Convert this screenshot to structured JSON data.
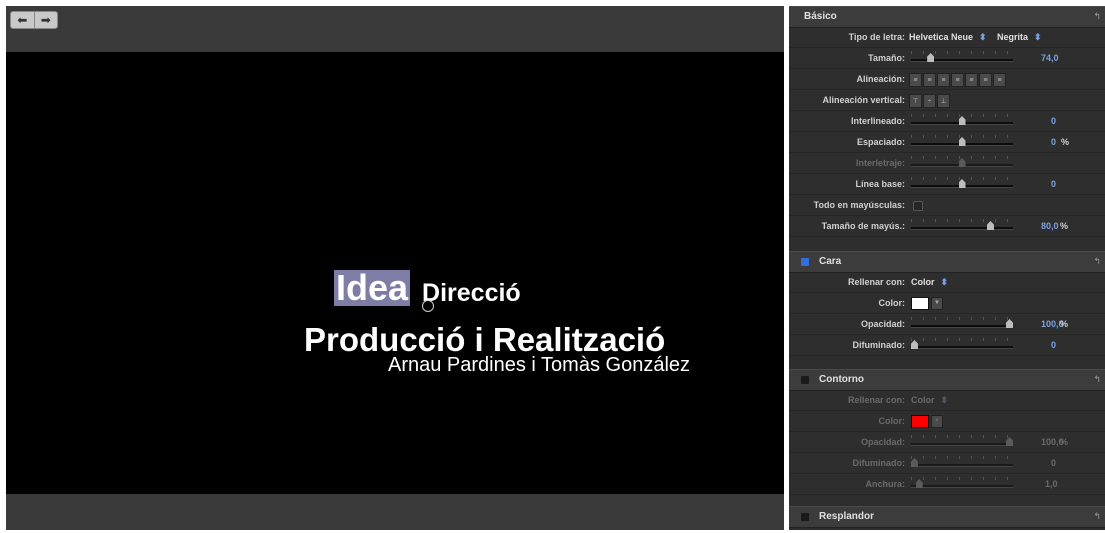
{
  "viewer": {
    "nav": {
      "back_icon": "arrow-left-icon",
      "forward_icon": "arrow-right-icon",
      "back_glyph": "⬅",
      "forward_glyph": "➡"
    },
    "title_line1_highlight": "Idea",
    "title_line1_rest": "Direcció",
    "title_line2": "Producció i Realització",
    "title_line3": "Arnau Pardines i Tomàs González"
  },
  "basic": {
    "header": "Básico",
    "font_label": "Tipo de letra:",
    "font_value": "Helvetica Neue",
    "weight_value": "Negrita",
    "size_label": "Tamaño:",
    "size_value": "74,0",
    "size_level": 0.17,
    "alignment_label": "Alineación:",
    "vertical_alignment_label": "Alineación vertical:",
    "line_spacing_label": "Interlineado:",
    "line_spacing_value": "0",
    "line_spacing_level": 0.5,
    "tracking_label": "Espaciado:",
    "tracking_value": "0",
    "tracking_unit": "%",
    "tracking_level": 0.5,
    "kerning_label": "Interletraje:",
    "kerning_level": 0.5,
    "baseline_label": "Línea base:",
    "baseline_value": "0",
    "baseline_level": 0.5,
    "all_caps_label": "Todo en mayúsculas:",
    "all_caps_checked": false,
    "caps_size_label": "Tamaño de mayús.:",
    "caps_size_value": "80,0",
    "caps_size_unit": "%",
    "caps_size_level": 0.8
  },
  "face": {
    "header": "Cara",
    "enabled": true,
    "fill_label": "Rellenar con:",
    "fill_value": "Color",
    "color_label": "Color:",
    "color": "#ffffff",
    "opacity_label": "Opacidad:",
    "opacity_value": "100,0",
    "opacity_unit": "%",
    "opacity_level": 1.0,
    "blur_label": "Difuminado:",
    "blur_value": "0",
    "blur_level": 0.0
  },
  "outline": {
    "header": "Contorno",
    "enabled": false,
    "fill_label": "Rellenar con:",
    "fill_value": "Color",
    "color_label": "Color:",
    "color": "#ff0000",
    "opacity_label": "Opacidad:",
    "opacity_value": "100,0",
    "opacity_unit": "%",
    "opacity_level": 1.0,
    "blur_label": "Difuminado:",
    "blur_value": "0",
    "blur_level": 0.0,
    "width_label": "Anchura:",
    "width_value": "1,0",
    "width_level": 0.05
  },
  "glow": {
    "header": "Resplandor",
    "enabled": false
  },
  "colors": {
    "accent_blue": "#2f6fe0",
    "value_blue": "#7aa2e0",
    "checkbox_off": "#1a1a1a"
  }
}
